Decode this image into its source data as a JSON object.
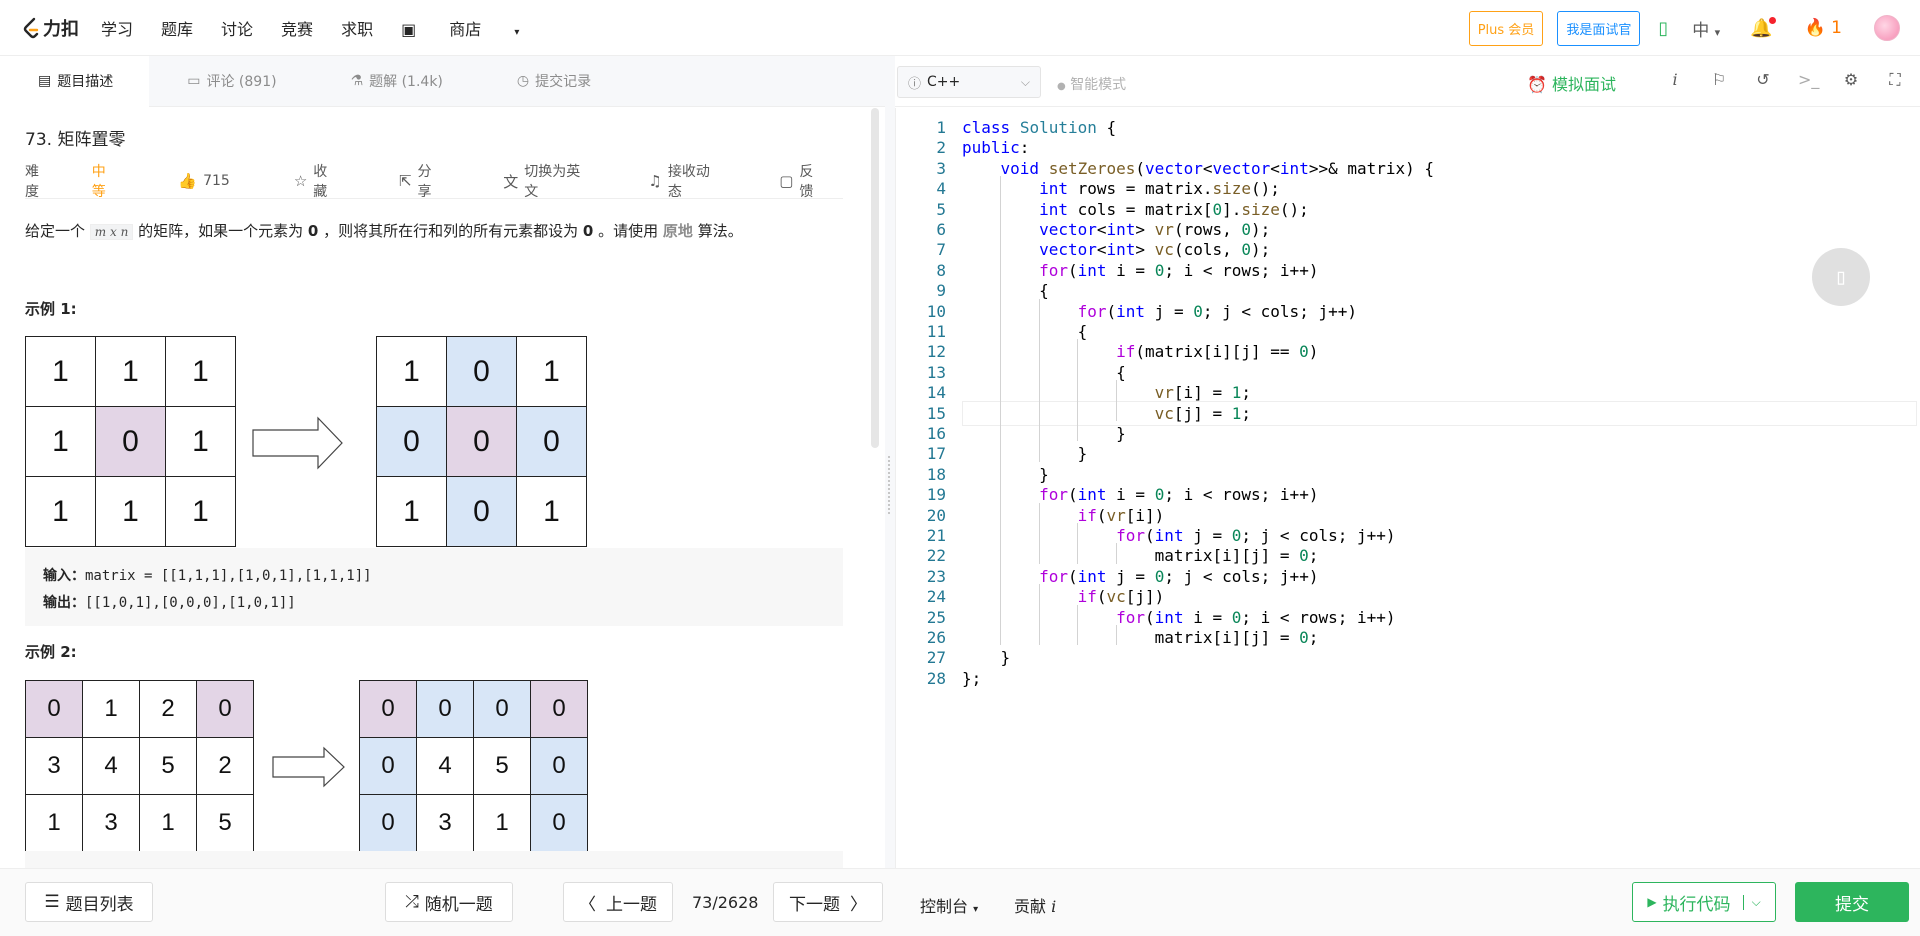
{
  "header": {
    "logo_text": "力扣",
    "nav": [
      "学习",
      "题库",
      "讨论",
      "竞赛",
      "求职"
    ],
    "shop_label": "商店",
    "plus_label": "Plus 会员",
    "interviewer_label": "我是面试官",
    "lang_label": "中",
    "streak_count": "1"
  },
  "tabs": {
    "description": "题目描述",
    "comments": "评论 (891)",
    "solutions": "题解 (1.4k)",
    "submissions": "提交记录"
  },
  "problem": {
    "title": "73. 矩阵置零",
    "difficulty_label": "难度",
    "difficulty": "中等",
    "likes": "715",
    "favorite": "收藏",
    "share": "分享",
    "switch_lang": "切换为英文",
    "subscribe": "接收动态",
    "feedback": "反馈",
    "desc_part1": "给定一个",
    "desc_code": "m x n",
    "desc_part2": "的矩阵，如果一个元素为",
    "desc_zero1": "0",
    "desc_part3": "，则将其所在行和列的所有元素都设为",
    "desc_zero2": "0",
    "desc_part4": "。请使用",
    "desc_inplace": "原地",
    "desc_part5": "算法。"
  },
  "example1": {
    "title": "示例 1:",
    "input_grid": [
      [
        "1",
        "1",
        "1"
      ],
      [
        "1",
        "0",
        "1"
      ],
      [
        "1",
        "1",
        "1"
      ]
    ],
    "output_grid": [
      [
        "1",
        "0",
        "1"
      ],
      [
        "0",
        "0",
        "0"
      ],
      [
        "1",
        "0",
        "1"
      ]
    ],
    "input_label": "输入：",
    "input_value": "matrix = [[1,1,1],[1,0,1],[1,1,1]]",
    "output_label": "输出：",
    "output_value": "[[1,0,1],[0,0,0],[1,0,1]]"
  },
  "example2": {
    "title": "示例 2:",
    "input_grid": [
      [
        "0",
        "1",
        "2",
        "0"
      ],
      [
        "3",
        "4",
        "5",
        "2"
      ],
      [
        "1",
        "3",
        "1",
        "5"
      ]
    ],
    "output_grid": [
      [
        "0",
        "0",
        "0",
        "0"
      ],
      [
        "0",
        "4",
        "5",
        "0"
      ],
      [
        "0",
        "3",
        "1",
        "0"
      ]
    ]
  },
  "editor": {
    "language": "C++",
    "smart_mode": "智能模式",
    "mock_interview": "模拟面试",
    "lines": [
      "class Solution {",
      "public:",
      "    void setZeroes(vector<vector<int>>& matrix) {",
      "        int rows = matrix.size();",
      "        int cols = matrix[0].size();",
      "        vector<int> vr(rows, 0);",
      "        vector<int> vc(cols, 0);",
      "        for(int i = 0; i < rows; i++)",
      "        {",
      "            for(int j = 0; j < cols; j++)",
      "            {",
      "                if(matrix[i][j] == 0)",
      "                {",
      "                    vr[i] = 1;",
      "                    vc[j] = 1;",
      "                }",
      "            }",
      "        }",
      "        for(int i = 0; i < rows; i++)",
      "            if(vr[i])",
      "                for(int j = 0; j < cols; j++)",
      "                    matrix[i][j] = 0;",
      "        for(int j = 0; j < cols; j++)",
      "            if(vc[j])",
      "                for(int i = 0; i < rows; i++)",
      "                    matrix[i][j] = 0;",
      "    }",
      "};"
    ]
  },
  "footer": {
    "problem_list": "题目列表",
    "random": "随机一题",
    "prev": "上一题",
    "page_counter": "73/2628",
    "next": "下一题",
    "console": "控制台",
    "contribute": "贡献",
    "run": "执行代码",
    "submit": "提交"
  },
  "colors": {
    "accent_orange": "#ffa116",
    "accent_green": "#2db55d",
    "accent_blue": "#1a90ff",
    "cell_pink": "#e3d5e6",
    "cell_blue": "#d8e6f7"
  }
}
